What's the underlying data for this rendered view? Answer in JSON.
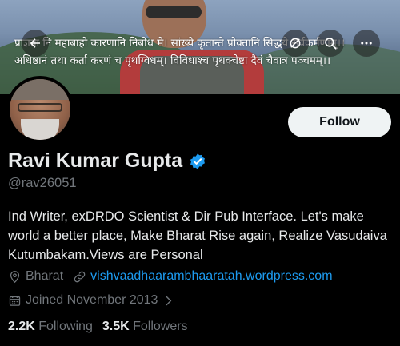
{
  "banner": {
    "verse_line1": "प्राज्ञता नि महाबाहो कारणानि निबोध मे। सांख्ये कृतान्ते प्रोक्तानि सिद्धये सर्वकर्मणाम्।।",
    "verse_line2": "अधिष्ठानं तथा कर्ता करणं च पृथग्विधम्। विविधाश्च पृथक्चेष्टा दैवं चैवात्र पञ्चमम्।।"
  },
  "nav": {
    "back_icon": "arrow-left-icon",
    "hide_icon": "eye-slash-icon",
    "search_icon": "search-icon",
    "more_icon": "more-horizontal-icon"
  },
  "profile": {
    "name": "Ravi Kumar Gupta",
    "handle": "@rav26051",
    "verified": true,
    "follow_label": "Follow",
    "bio": "Ind Writer, exDRDO Scientist & Dir Pub Interface. Let's make world a better place, Make Bharat Rise again, Realize Vasudaiva Kutumbakam.Views are Personal",
    "location": "Bharat",
    "website": "vishvaadhaarambhaaratah.wordpress.com",
    "joined": "Joined November 2013",
    "following_count": "2.2K",
    "following_label": "Following",
    "followers_count": "3.5K",
    "followers_label": "Followers"
  },
  "colors": {
    "background": "#000000",
    "text_primary": "#e7e9ea",
    "text_secondary": "#71767b",
    "link": "#1d9bf0",
    "verified": "#1d9bf0",
    "follow_button_bg": "#eff3f4"
  }
}
